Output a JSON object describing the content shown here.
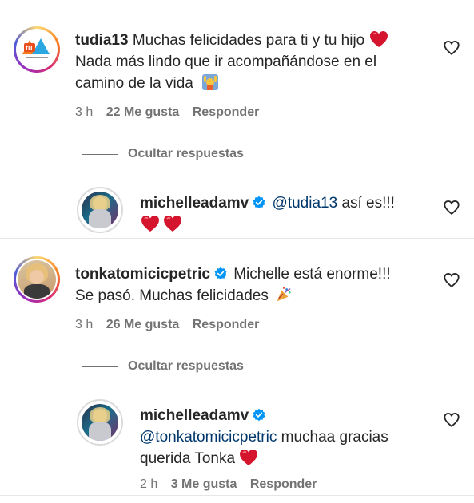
{
  "comments": [
    {
      "username": "tudia13",
      "text_line1": "Muchas felicidades para ti y tu hijo",
      "text_line2": "Nada más lindo que ir acompañándose en el",
      "text_line3": "camino de la vida",
      "time": "3 h",
      "likes": "22 Me gusta",
      "reply": "Responder",
      "avatar_label": "tu",
      "hide_replies": "Ocultar respuestas",
      "replies": [
        {
          "username": "michelleadamv",
          "mention": "@tudia13",
          "text": "así es!!!"
        }
      ]
    },
    {
      "username": "tonkatomicicpetric",
      "text_line1": "Michelle está enorme!!!",
      "text_line2": "Se pasó. Muchas felicidades",
      "time": "3 h",
      "likes": "26 Me gusta",
      "reply": "Responder",
      "hide_replies": "Ocultar respuestas",
      "replies": [
        {
          "username": "michelleadamv",
          "mention": "@tonkatomicicpetric",
          "text_after_mention": "muchaa gracias",
          "text_line2": "querida Tonka",
          "time": "2 h",
          "likes": "3 Me gusta",
          "reply": "Responder"
        }
      ]
    }
  ],
  "colors": {
    "verified": "#0095f6",
    "heart": "#ed1c3a",
    "mention": "#00376b",
    "muted": "#737373"
  },
  "icons": [
    "heart-outline-icon",
    "verified-badge-icon",
    "red-heart-emoji-icon",
    "raising-hands-emoji-icon",
    "party-popper-emoji-icon"
  ]
}
